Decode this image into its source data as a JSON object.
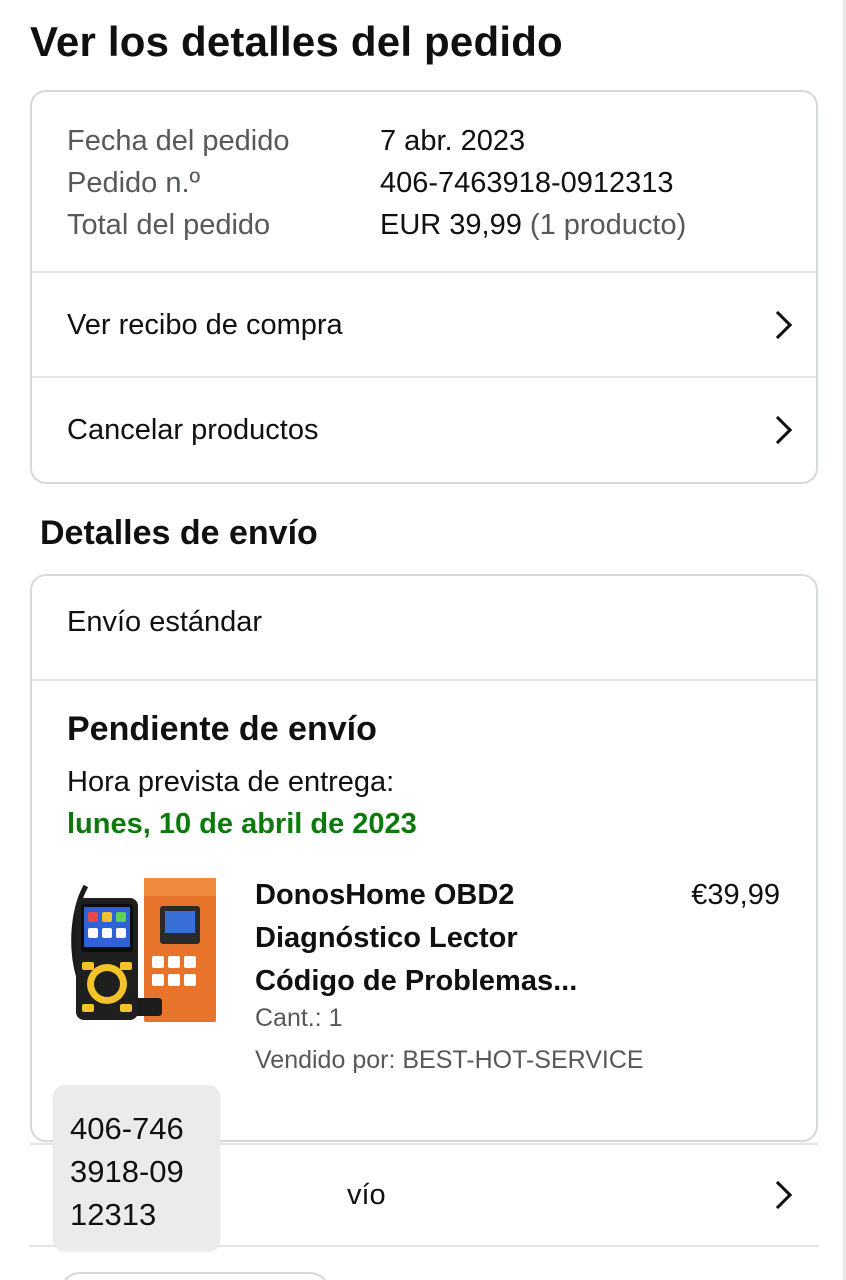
{
  "page": {
    "title": "Ver los detalles del pedido"
  },
  "summary": {
    "date_label": "Fecha del pedido",
    "date_value": "7 abr. 2023",
    "order_label": "Pedido n.º",
    "order_value": "406-7463918-0912313",
    "total_label": "Total del pedido",
    "total_value": "EUR 39,99",
    "total_items": "(1 producto)"
  },
  "actions": {
    "receipt": "Ver recibo de compra",
    "cancel": "Cancelar productos"
  },
  "shipping": {
    "section_title": "Detalles de envío",
    "method": "Envío estándar",
    "status": "Pendiente de envío",
    "eta_label": "Hora prevista de entrega:",
    "eta_date": "lunes, 10 de abril de 2023",
    "eta_color": "#0b7a0b"
  },
  "product": {
    "title_line1": "DonosHome OBD2",
    "title_line2": "Diagnóstico Lector",
    "title_line3": "Código de Problemas...",
    "price": "€39,99",
    "qty": "Cant.: 1",
    "seller": "Vendido por: BEST-HOT-SERVICE",
    "image_icon": "obd2-scanner-product-image"
  },
  "tracking": {
    "label_visible": "vío"
  },
  "tooltip": {
    "line1": "406-746",
    "line2": "3918-09",
    "line3": "12313"
  }
}
